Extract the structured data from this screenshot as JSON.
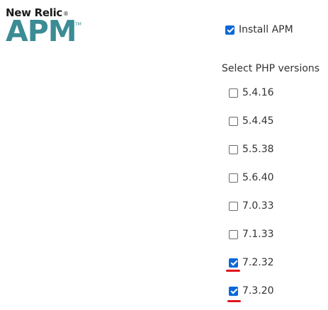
{
  "logo": {
    "brand": "New Relic",
    "registered": "®",
    "product": "APM",
    "trademark": "TM"
  },
  "install_apm": {
    "label": "Install APM",
    "checked": true
  },
  "php_versions": {
    "heading": "Select PHP versions",
    "options": [
      {
        "label": "5.4.16",
        "checked": false,
        "highlighted": false
      },
      {
        "label": "5.4.45",
        "checked": false,
        "highlighted": false
      },
      {
        "label": "5.5.38",
        "checked": false,
        "highlighted": false
      },
      {
        "label": "5.6.40",
        "checked": false,
        "highlighted": false
      },
      {
        "label": "7.0.33",
        "checked": false,
        "highlighted": false
      },
      {
        "label": "7.1.33",
        "checked": false,
        "highlighted": false
      },
      {
        "label": "7.2.32",
        "checked": true,
        "highlighted": true
      },
      {
        "label": "7.3.20",
        "checked": true,
        "highlighted": true
      }
    ]
  },
  "colors": {
    "accent": "#0b68d8",
    "brand_teal": "#3b8c94",
    "annotation_red": "#e0141e"
  }
}
